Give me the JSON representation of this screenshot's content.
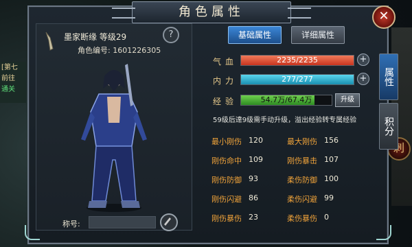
{
  "window": {
    "title": "角色属性"
  },
  "background": {
    "quest_lines": [
      {
        "text": "[第七",
        "color": "#e8d39a"
      },
      {
        "text": "前往",
        "color": "#e8d39a"
      },
      {
        "text": "通关",
        "color": "#5fe07a"
      }
    ],
    "skill_orb_label": "刺"
  },
  "character": {
    "name_level": "墨家断缘 等级29",
    "id_line": "角色编号: 1601226305",
    "title_label": "称号:",
    "title_value": ""
  },
  "tabs": {
    "basic": "基础属性",
    "detail": "详细属性"
  },
  "side_tabs": {
    "attrs": "属性",
    "points": "积分"
  },
  "bars": {
    "hp": {
      "label": "气血",
      "text": "2235/2235",
      "fill": 1.0,
      "color": "#e2543a"
    },
    "mp": {
      "label": "内力",
      "text": "277/277",
      "fill": 1.0,
      "color": "#2fb5d4"
    },
    "exp": {
      "label": "经验",
      "text": "54.7万/67.4万",
      "fill": 0.81,
      "color": "#46b33c"
    }
  },
  "upgrade_label": "升级",
  "note": "59级后達9级需手动升级，溢出经验转专属经验",
  "attributes": [
    {
      "name": "最小刚伤",
      "value": "120"
    },
    {
      "name": "最大刚伤",
      "value": "156"
    },
    {
      "name": "刚伤命中",
      "value": "109"
    },
    {
      "name": "刚伤暴击",
      "value": "107"
    },
    {
      "name": "刚伤防御",
      "value": "93"
    },
    {
      "name": "柔伤防御",
      "value": "100"
    },
    {
      "name": "刚伤闪避",
      "value": "86"
    },
    {
      "name": "柔伤闪避",
      "value": "99"
    },
    {
      "name": "刚伤暴伤",
      "value": "23"
    },
    {
      "name": "柔伤暴伤",
      "value": "0"
    }
  ]
}
